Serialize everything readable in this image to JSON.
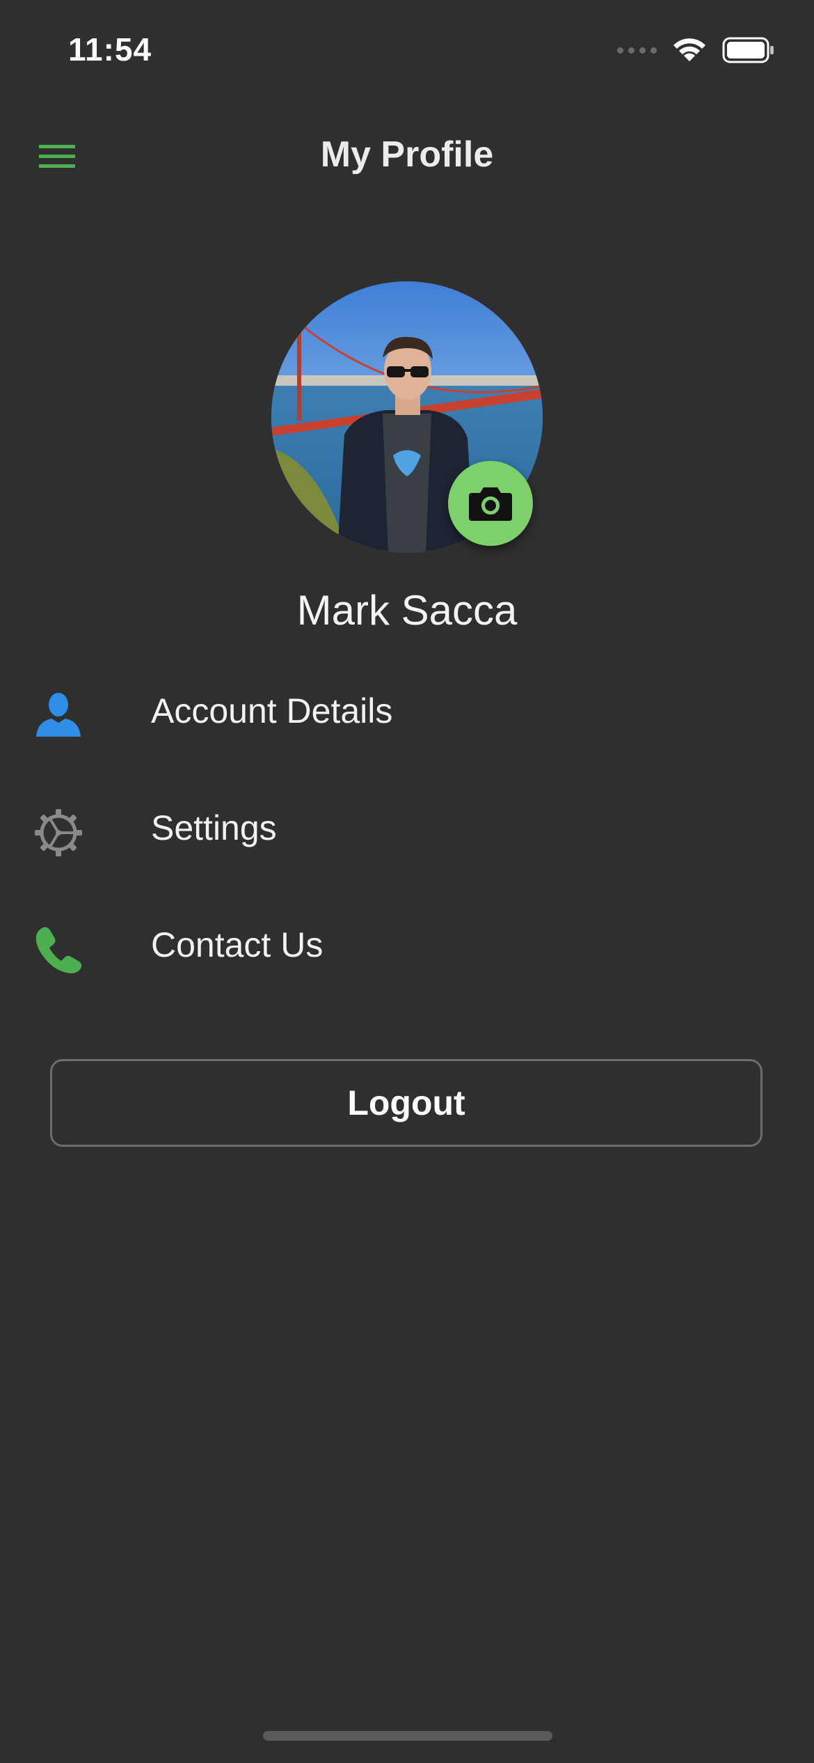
{
  "status_bar": {
    "time": "11:54"
  },
  "header": {
    "title": "My Profile",
    "menu_icon": "hamburger-menu-icon",
    "accent_color": "#4caf50"
  },
  "profile": {
    "name": "Mark Sacca",
    "camera_icon": "camera-icon",
    "camera_button_color": "#7ed06a"
  },
  "menu": {
    "items": [
      {
        "label": "Account Details",
        "icon": "user-icon",
        "icon_color": "#2f8fe8"
      },
      {
        "label": "Settings",
        "icon": "gear-icon",
        "icon_color": "#8a8a8a"
      },
      {
        "label": "Contact Us",
        "icon": "phone-icon",
        "icon_color": "#4caf50"
      }
    ]
  },
  "logout": {
    "label": "Logout"
  }
}
